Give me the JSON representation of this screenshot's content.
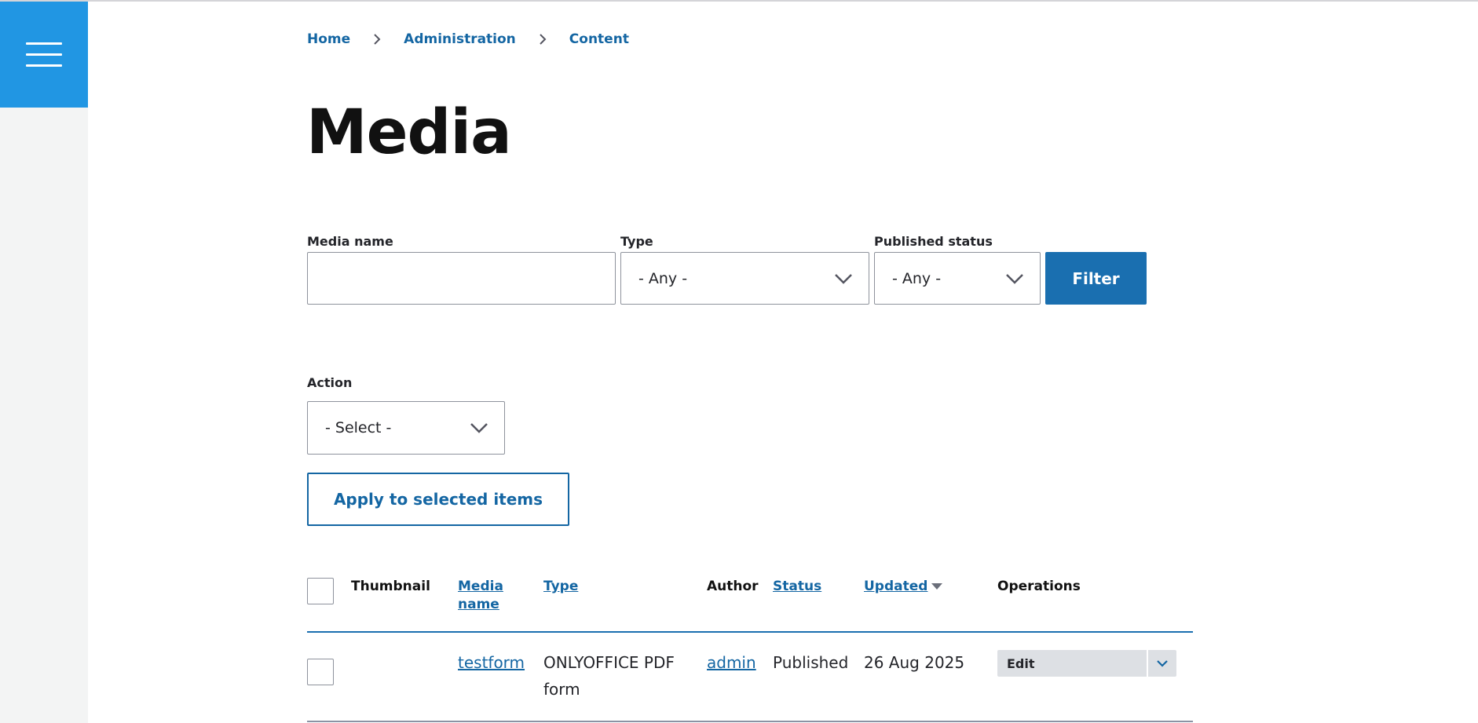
{
  "breadcrumb": {
    "items": [
      "Home",
      "Administration",
      "Content"
    ]
  },
  "page": {
    "title": "Media"
  },
  "filters": {
    "media_name": {
      "label": "Media name",
      "value": "",
      "placeholder": ""
    },
    "type": {
      "label": "Type",
      "selected": "- Any -"
    },
    "published_status": {
      "label": "Published status",
      "selected": "- Any -"
    },
    "submit_label": "Filter"
  },
  "bulk": {
    "action_label": "Action",
    "action_selected": "- Select -",
    "apply_label": "Apply to selected items"
  },
  "table": {
    "columns": {
      "thumbnail": "Thumbnail",
      "media_name_line1": "Media",
      "media_name_line2": "name",
      "type": "Type",
      "author": "Author",
      "status": "Status",
      "updated": "Updated",
      "operations": "Operations"
    },
    "rows": [
      {
        "media_name": "testform",
        "type_line1": "ONLYOFFICE PDF",
        "type_line2": "form",
        "author": "admin",
        "status": "Published",
        "updated": "26 Aug 2025",
        "operation": "Edit"
      }
    ]
  },
  "icons": {
    "menu": "hamburger-icon",
    "breadcrumb_separator": "chevron-right-icon",
    "select_arrow": "chevron-down-icon",
    "sort": "sort-descending-icon"
  },
  "colors": {
    "accent": "#2196e3",
    "link": "#1466a3",
    "primary_button": "#1a6fb0",
    "rail": "#f3f4f4"
  }
}
